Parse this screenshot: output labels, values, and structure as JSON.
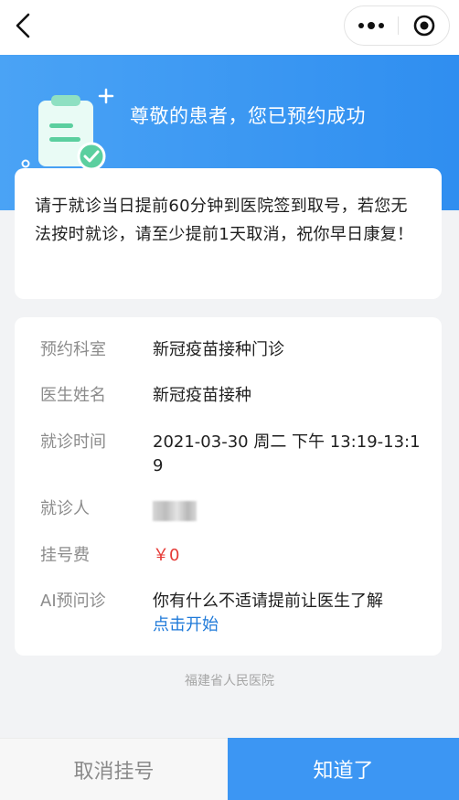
{
  "navbar": {
    "back_icon": "chevron-left-icon",
    "more_icon": "more-dots-icon",
    "close_icon": "target-circle-icon"
  },
  "banner": {
    "title": "尊敬的患者，您已预约成功",
    "icon": "clipboard-check-icon",
    "colors": {
      "start": "#4aa3f5",
      "end": "#2f8ef0"
    }
  },
  "notice": {
    "text": "请于就诊当日提前60分钟到医院签到取号，若您无法按时就诊，请至少提前1天取消，祝你早日康复！"
  },
  "details": {
    "department_label": "预约科室",
    "department_value": "新冠疫苗接种门诊",
    "doctor_label": "医生姓名",
    "doctor_value": "新冠疫苗接种",
    "time_label": "就诊时间",
    "time_value": "2021-03-30 周二 下午 13:19-13:19",
    "patient_label": "就诊人",
    "fee_label": "挂号费",
    "fee_value": "￥0",
    "ai_label": "AI预问诊",
    "ai_value": "你有什么不适请提前让医生了解",
    "ai_link": "点击开始"
  },
  "footer": {
    "hospital": "福建省人民医院"
  },
  "actions": {
    "cancel_label": "取消挂号",
    "ok_label": "知道了"
  },
  "colors": {
    "accent": "#3c96f3",
    "link": "#1f7ad9",
    "fee": "#e53935"
  }
}
